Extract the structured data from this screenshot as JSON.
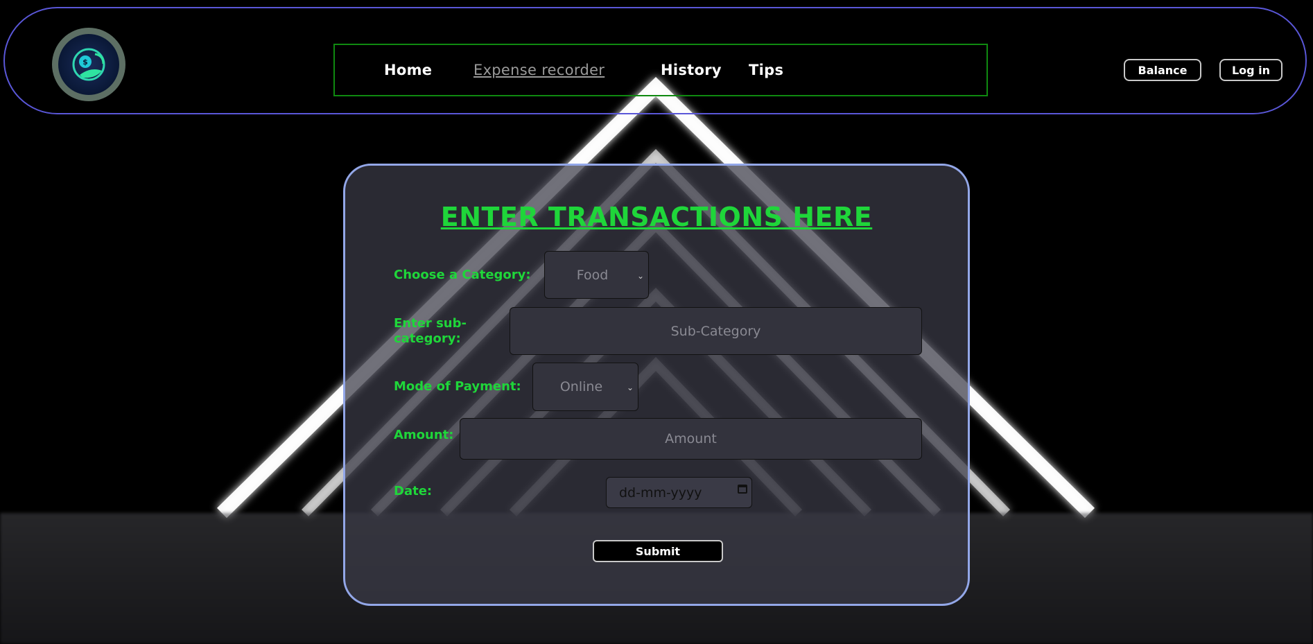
{
  "nav": {
    "items": [
      {
        "label": "Home"
      },
      {
        "label": "Expense recorder",
        "active": true
      },
      {
        "label": "History"
      },
      {
        "label": "Tips"
      }
    ]
  },
  "header_buttons": {
    "balance": "Balance",
    "login": "Log in"
  },
  "form": {
    "title": "ENTER TRANSACTIONS HERE",
    "category": {
      "label": "Choose a Category:",
      "value": "Food"
    },
    "subcategory": {
      "label": "Enter sub-category:",
      "placeholder": "Sub-Category"
    },
    "payment": {
      "label": "Mode of Payment:",
      "value": "Online"
    },
    "amount": {
      "label": "Amount:",
      "placeholder": "Amount"
    },
    "date": {
      "label": "Date:",
      "placeholder": "dd-mm-yyyy"
    },
    "submit": "Submit"
  },
  "colors": {
    "accent_green": "#1fd63a",
    "header_border": "#5a57d8",
    "nav_border": "#0f8a10",
    "card_border": "#93a7e8"
  }
}
